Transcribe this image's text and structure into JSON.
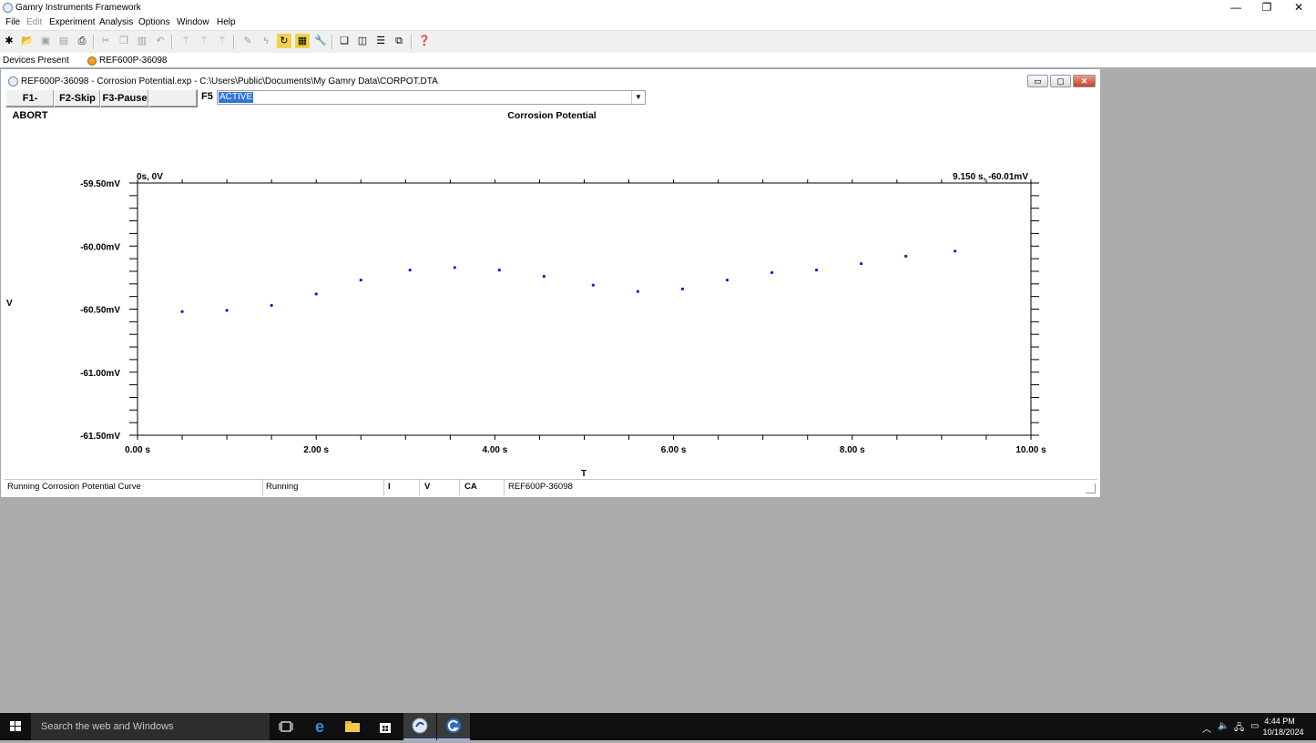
{
  "app": {
    "title": "Gamry Instruments Framework",
    "window_controls": {
      "minimize": "—",
      "restore": "❐",
      "close": "✕"
    }
  },
  "menu": [
    "File",
    "Edit",
    "Experiment",
    "Analysis",
    "Options",
    "Window",
    "Help"
  ],
  "toolbar": {
    "icons": [
      "new-icon",
      "open-icon",
      "save-icon",
      "save-all-icon",
      "print-icon",
      "cut-icon",
      "copy-icon",
      "paste-icon",
      "undo-icon",
      "wand-icon",
      "wand2-icon",
      "wand3-icon",
      "pen-icon",
      "lightning-icon",
      "refresh-icon",
      "pattern-icon",
      "wrench-icon",
      "cascade-icon",
      "tile-vertical-icon",
      "tile-horizontal-icon",
      "arrange-icon",
      "help-icon"
    ]
  },
  "devices": {
    "label": "Devices Present",
    "device": "REF600P-36098"
  },
  "child_window": {
    "title": "REF600P-36098 - Corrosion Potential.exp - C:\\Users\\Public\\Documents\\My Gamry Data\\CORPOT.DTA"
  },
  "fkeys": {
    "f1": "F1-ABORT",
    "f2": "F2-Skip",
    "f3": "F3-Pause",
    "f5_label": "F5",
    "status_value": "ACTIVE"
  },
  "chart_data": {
    "type": "scatter",
    "title": "Corrosion Potential",
    "xlabel": "T",
    "ylabel": "V",
    "xlim": [
      0,
      10
    ],
    "ylim": [
      -61.5,
      -59.5
    ],
    "x_ticks": [
      "0.00 s",
      "2.00 s",
      "4.00 s",
      "6.00 s",
      "8.00 s",
      "10.00 s"
    ],
    "y_ticks": [
      "-59.50mV",
      "-60.00mV",
      "-60.50mV",
      "-61.00mV",
      "-61.50mV"
    ],
    "corner_left_label": "0s, 0V",
    "corner_right_label": "9.150 s, -60.01mV",
    "point_color": "#1a1acc",
    "x": [
      0.5,
      1.0,
      1.5,
      2.0,
      2.5,
      3.05,
      3.55,
      4.05,
      4.55,
      5.1,
      5.6,
      6.1,
      6.6,
      7.1,
      7.6,
      8.1,
      8.6,
      9.15
    ],
    "y": [
      -60.52,
      -60.51,
      -60.47,
      -60.38,
      -60.27,
      -60.19,
      -60.17,
      -60.19,
      -60.24,
      -60.31,
      -60.36,
      -60.34,
      -60.27,
      -60.21,
      -60.19,
      -60.14,
      -60.08,
      -60.04
    ]
  },
  "statusbar": {
    "message": "Running Corrosion Potential Curve",
    "state": "Running",
    "i_label": "I",
    "v_label": "V",
    "mode": "CA",
    "device": "REF600P-36098"
  },
  "taskbar": {
    "search_placeholder": "Search the web and Windows",
    "time": "4:44 PM",
    "date": "10/18/2024"
  }
}
